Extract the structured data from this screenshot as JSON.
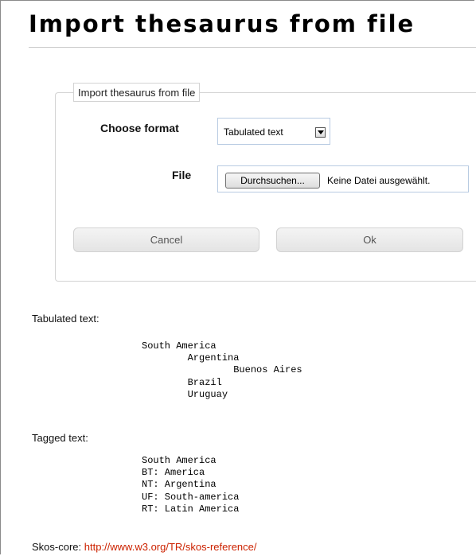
{
  "page": {
    "title": "Import thesaurus from file"
  },
  "form": {
    "legend": "Import thesaurus from file",
    "format_label": "Choose format",
    "format_selected": "Tabulated text",
    "file_label": "File",
    "browse_label": "Durchsuchen...",
    "file_status": "Keine Datei ausgewählt.",
    "cancel_label": "Cancel",
    "ok_label": "Ok"
  },
  "examples": {
    "tabulated_label": "Tabulated text:",
    "tabulated_lines": [
      "South America",
      "        Argentina",
      "                Buenos Aires",
      "        Brazil",
      "        Uruguay"
    ],
    "tagged_label": "Tagged text:",
    "tagged_lines": [
      "South America",
      "BT: America",
      "NT: Argentina",
      "UF: South-america",
      "RT: Latin America"
    ],
    "skos_label": "Skos-core:",
    "skos_link": "http://www.w3.org/TR/skos-reference/"
  },
  "colors": {
    "link": "#cc2200",
    "input_border": "#b8cbe2",
    "fieldset_border": "#d3d3d3"
  },
  "icons": {
    "select_arrow": "chevron-down-icon"
  }
}
